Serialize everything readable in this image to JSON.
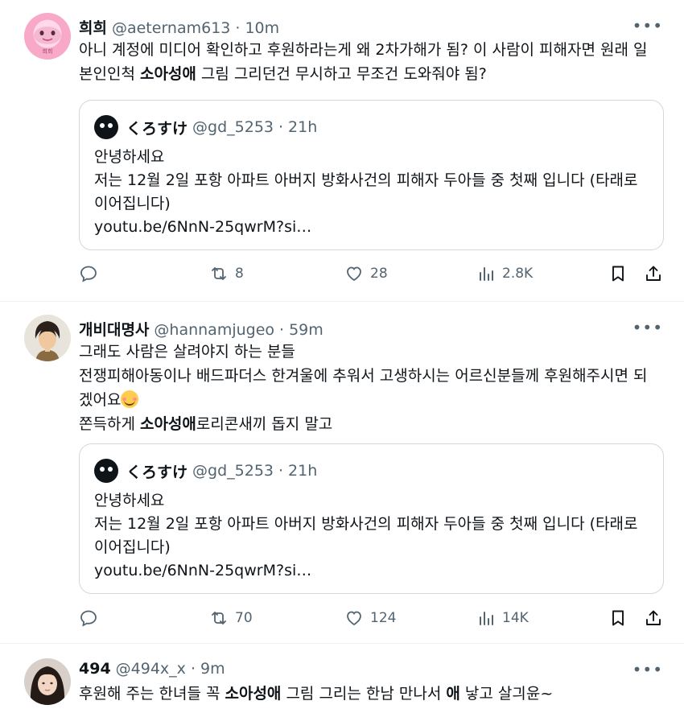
{
  "tweets": [
    {
      "name": "희희",
      "handle": "@aeternam613",
      "time": "10m",
      "avatar_label": "희희",
      "text_lines": [
        [
          "아니 계정에 미디어 확인하고 후원하라는게 왜 2차가해가 됨? 이 사람이 피해자면 원래 일"
        ],
        [
          "본인인척 ",
          "소아성애",
          " 그림 그리던건 무시하고 무조건 도와줘야 됨?"
        ]
      ],
      "quote": {
        "name": "くろすけ",
        "handle": "@gd_5253",
        "time": "21h",
        "lines": [
          "안녕하세요",
          "저는 12월 2일 포항 아파트 아버지 방화사건의 피해자 두아들 중 첫째 입니다 (타래로",
          "이어집니다)",
          "youtu.be/6NnN-25qwrM?si…"
        ]
      },
      "stats": {
        "reposts": "8",
        "likes": "28",
        "views": "2.8K"
      }
    },
    {
      "name": "개비대명사",
      "handle": "@hannamjugeo",
      "time": "59m",
      "text_lines": [
        [
          "그래도 사람은 살려야지 하는 분들"
        ],
        [
          "전쟁피해아동이나 배드파더스 한겨울에 추워서 고생하시는 어르신분들께 후원해주시면 되"
        ],
        [
          "겠어요"
        ],
        [
          "쫀득하게 ",
          "소아성애",
          "로리콘새끼 돕지 말고"
        ]
      ],
      "quote": {
        "name": "くろすけ",
        "handle": "@gd_5253",
        "time": "21h",
        "lines": [
          "안녕하세요",
          "저는 12월 2일 포항 아파트 아버지 방화사건의 피해자 두아들 중 첫째 입니다 (타래로",
          "이어집니다)",
          "youtu.be/6NnN-25qwrM?si…"
        ]
      },
      "stats": {
        "reposts": "70",
        "likes": "124",
        "views": "14K"
      }
    },
    {
      "name": "494",
      "handle": "@494x_x",
      "time": "9m",
      "text_lines": [
        [
          "후원해 주는 한녀들 꼭 ",
          "소아성애",
          " 그림 그리는 한남 만나서 ",
          "애",
          " 낳고 살긔윤~"
        ]
      ]
    }
  ],
  "icons": {
    "reply": "reply-icon",
    "repost": "repost-icon",
    "like": "heart-icon",
    "views": "views-icon",
    "bookmark": "bookmark-icon",
    "share": "share-icon",
    "more": "more-icon"
  },
  "colors": {
    "secondary_text": "#536471",
    "border": "#cfd9de",
    "primary_text": "#0f1419"
  }
}
